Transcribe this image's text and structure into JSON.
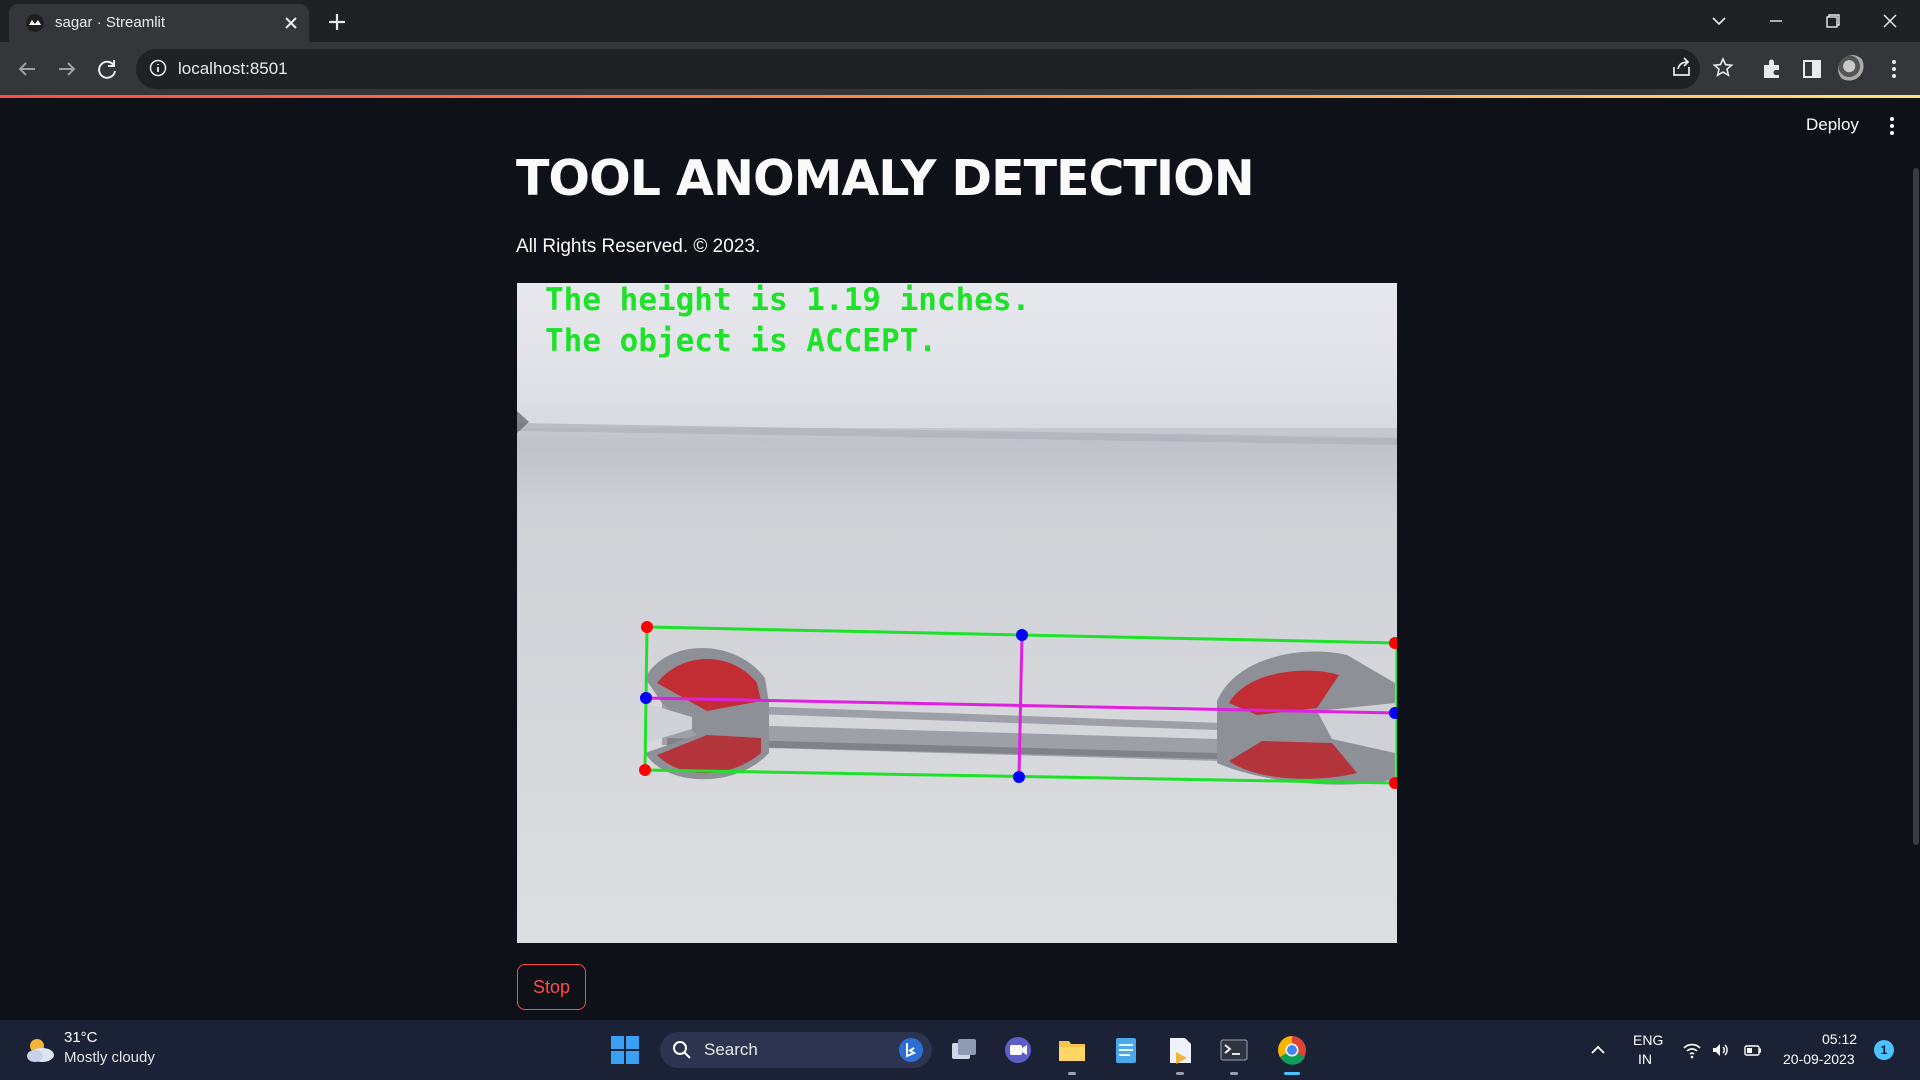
{
  "browser": {
    "tab_title": "sagar · Streamlit",
    "url": "localhost:8501"
  },
  "app": {
    "deploy_label": "Deploy",
    "title": "TOOL ANOMALY DETECTION",
    "copyright": "All Rights Reserved. © 2023.",
    "overlay": {
      "height_text": "The height is 1.19 inches.",
      "status_text": "The object is ACCEPT.",
      "text_color": "#1ee12a",
      "box_color": "#1ee12a",
      "axis_color": "#e020e0",
      "corner_color": "#ff0000",
      "midpoint_color": "#0000ff"
    },
    "stop_label": "Stop",
    "accent": "#ff4b4b"
  },
  "taskbar": {
    "temperature": "31°C",
    "condition": "Mostly cloudy",
    "search_label": "Search",
    "lang_line1": "ENG",
    "lang_line2": "IN",
    "time": "05:12",
    "date": "20-09-2023",
    "notification_count": "1"
  }
}
